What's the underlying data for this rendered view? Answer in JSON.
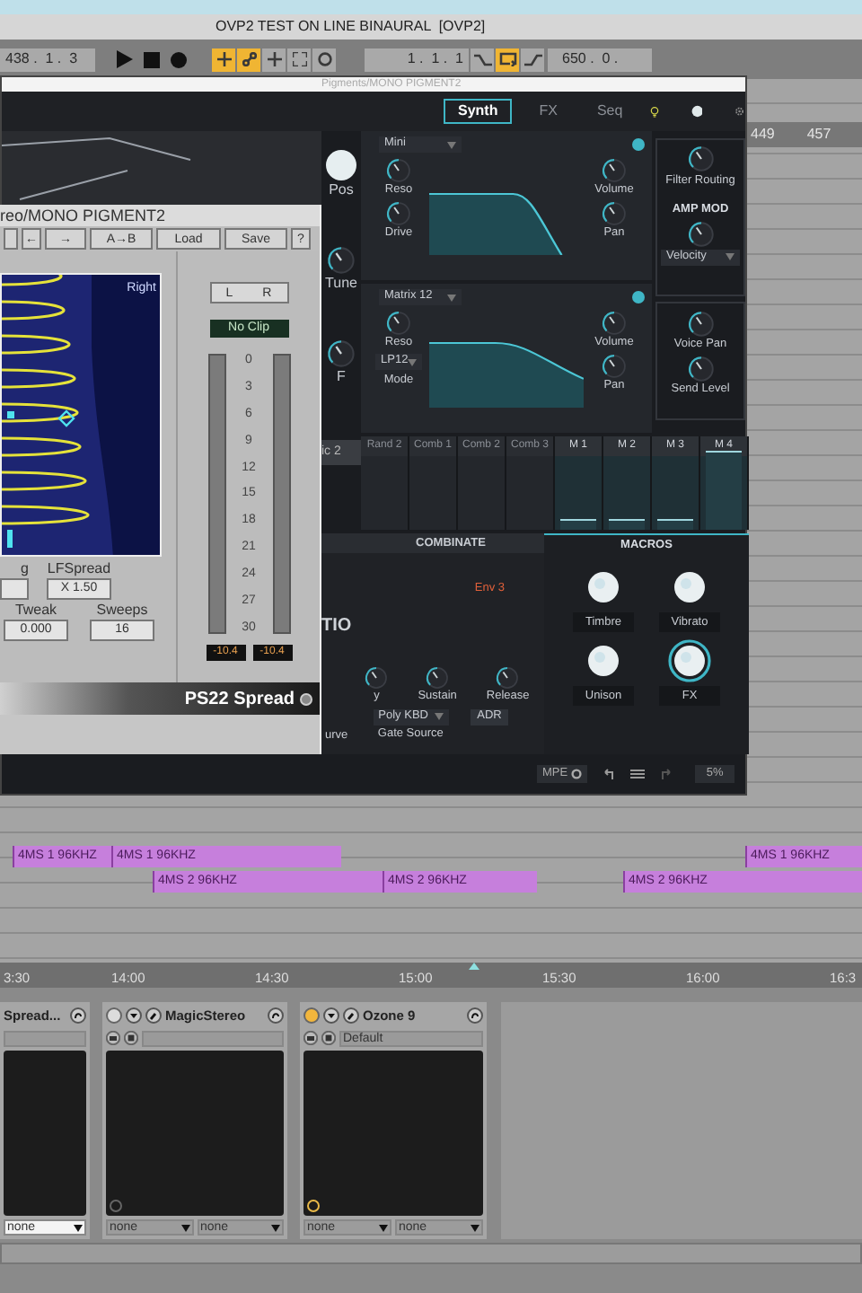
{
  "title": "OVP2 TEST ON LINE BINAURAL  [OVP2]",
  "transport": {
    "position": "438 .  1 .  3",
    "toggles": [
      {
        "kind": "add",
        "on": true
      },
      {
        "kind": "automation",
        "on": true
      },
      {
        "kind": "add",
        "on": false
      },
      {
        "kind": "capture",
        "on": false
      },
      {
        "kind": "circle",
        "on": false
      }
    ],
    "loop_start": "1 .  1 .  1",
    "loop_toggles": [
      {
        "kind": "punch-in",
        "on": false
      },
      {
        "kind": "loop",
        "on": true
      },
      {
        "kind": "punch-out",
        "on": false
      }
    ],
    "loop_length": "650 .  0 ."
  },
  "ruler": [
    "449",
    "457"
  ],
  "synth": {
    "window_title": "Pigments/MONO PIGMENT2",
    "tabs": [
      {
        "label": "Synth",
        "selected": true
      },
      {
        "label": "FX",
        "selected": false
      },
      {
        "label": "Seq",
        "selected": false
      }
    ],
    "engine_labels": [
      "Pos",
      "Tune",
      "F"
    ],
    "engine_tab": "ic 2",
    "section_cut": "TIO",
    "filters": [
      {
        "type": "Mini",
        "on": true,
        "knobs": [
          "Reso",
          "Drive"
        ],
        "outputs": [
          "Volume",
          "Pan"
        ]
      },
      {
        "type": "Matrix 12",
        "on": true,
        "knobs": [
          "Reso"
        ],
        "mode": "LP12",
        "mode_label": "Mode",
        "outputs": [
          "Volume",
          "Pan"
        ]
      }
    ],
    "routing": {
      "label": "Filter Routing",
      "amp_mod": "AMP MOD",
      "amp_mod_source": "Velocity",
      "knobs": [
        "Voice Pan",
        "Send Level"
      ]
    },
    "mod_sources": [
      {
        "label": "Rand 2",
        "kind": "function"
      },
      {
        "label": "Comb 1",
        "kind": "function"
      },
      {
        "label": "Comb 2",
        "kind": "function"
      },
      {
        "label": "Comb 3",
        "kind": "function"
      },
      {
        "label": "M 1",
        "kind": "macro",
        "level": 0.12
      },
      {
        "label": "M 2",
        "kind": "macro",
        "level": 0.12
      },
      {
        "label": "M 3",
        "kind": "macro",
        "level": 0.12
      },
      {
        "label": "M 4",
        "kind": "macro",
        "level": 0.85
      }
    ],
    "combinate": {
      "title": "COMBINATE",
      "source": "Env 3",
      "knobs": [
        "y",
        "Sustain",
        "Release"
      ],
      "curve_label": "urve",
      "gate_source": "Poly KBD",
      "gate_label": "Gate Source",
      "mode": "ADR"
    },
    "macros": {
      "title": "MACROS",
      "knobs": [
        {
          "label": "Timbre",
          "highlighted": false
        },
        {
          "label": "Vibrato",
          "highlighted": false
        },
        {
          "label": "Unison",
          "highlighted": false
        },
        {
          "label": "FX",
          "highlighted": true
        }
      ]
    },
    "footer": {
      "mpe": "MPE",
      "cpu": "5%"
    }
  },
  "spread_plugin": {
    "title": "reo/MONO PIGMENT2",
    "toolbar": [
      "←",
      "→",
      "A→B",
      "Load",
      "Save",
      "?"
    ],
    "display_label": "Right",
    "channel_buttons": [
      "L",
      "R"
    ],
    "clip": "No Clip",
    "scale": [
      "0",
      "3",
      "6",
      "9",
      "12",
      "15",
      "18",
      "21",
      "24",
      "27",
      "30"
    ],
    "readings": [
      "-10.4",
      "-10.4"
    ],
    "params": [
      {
        "label": "g"
      },
      {
        "label": "LFSpread",
        "value": "X 1.50"
      },
      {
        "label": "Tweak",
        "value": "0.000"
      },
      {
        "label": "Sweeps",
        "value": "16"
      }
    ],
    "name": "PS22 Spread"
  },
  "clip_lanes": [
    [
      {
        "label": "4MS 1 96KHZ"
      },
      {
        "label": "4MS 1 96KHZ"
      },
      {
        "label": "4MS 1 96KHZ"
      }
    ],
    [
      {
        "label": "4MS 2 96KHZ"
      },
      {
        "label": "4MS 2 96KHZ"
      },
      {
        "label": "4MS 2 96KHZ"
      }
    ]
  ],
  "time_ruler": [
    "3:30",
    "14:00",
    "14:30",
    "15:00",
    "15:30",
    "16:00",
    "16:3"
  ],
  "devices": [
    {
      "name": "Spread...",
      "selects": [
        "none"
      ]
    },
    {
      "name": "MagicStereo",
      "on": false,
      "selects": [
        "none",
        "none"
      ]
    },
    {
      "name": "Ozone 9",
      "on": true,
      "preset": "Default",
      "selects": [
        "none",
        "none"
      ]
    }
  ]
}
